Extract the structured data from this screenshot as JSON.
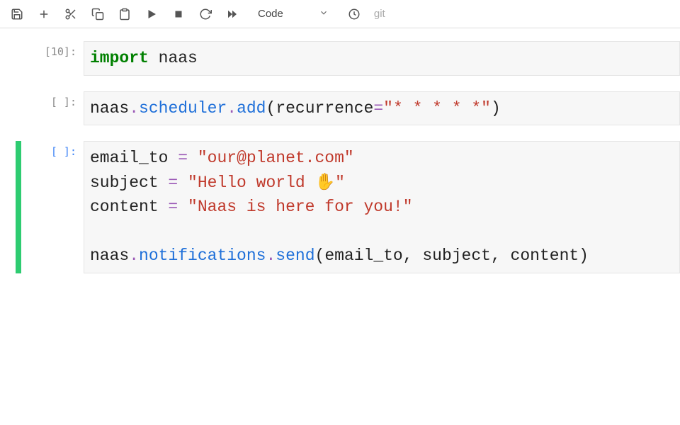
{
  "toolbar": {
    "cell_type": "Code",
    "git_label": "git"
  },
  "cells": [
    {
      "prompt": "[10]:",
      "active": false,
      "tokens": [
        {
          "t": "import",
          "c": "kw"
        },
        {
          "t": " ",
          "c": "name"
        },
        {
          "t": "naas",
          "c": "name"
        }
      ]
    },
    {
      "prompt": "[ ]:",
      "active": false,
      "tokens": [
        {
          "t": "naas",
          "c": "name"
        },
        {
          "t": ".",
          "c": "op"
        },
        {
          "t": "scheduler",
          "c": "call"
        },
        {
          "t": ".",
          "c": "op"
        },
        {
          "t": "add",
          "c": "call"
        },
        {
          "t": "(",
          "c": "paren"
        },
        {
          "t": "recurrence",
          "c": "name"
        },
        {
          "t": "=",
          "c": "op"
        },
        {
          "t": "\"* * * * *\"",
          "c": "str"
        },
        {
          "t": ")",
          "c": "paren"
        }
      ]
    },
    {
      "prompt": "[ ]:",
      "active": true,
      "tokens": [
        {
          "t": "email_to ",
          "c": "name"
        },
        {
          "t": "=",
          "c": "op"
        },
        {
          "t": " ",
          "c": "name"
        },
        {
          "t": "\"our@planet.com\"",
          "c": "str"
        },
        {
          "t": "\n",
          "c": "name"
        },
        {
          "t": "subject ",
          "c": "name"
        },
        {
          "t": "=",
          "c": "op"
        },
        {
          "t": " ",
          "c": "name"
        },
        {
          "t": "\"Hello world ✋\"",
          "c": "str"
        },
        {
          "t": "\n",
          "c": "name"
        },
        {
          "t": "content ",
          "c": "name"
        },
        {
          "t": "=",
          "c": "op"
        },
        {
          "t": " ",
          "c": "name"
        },
        {
          "t": "\"Naas is here for you!\"",
          "c": "str"
        },
        {
          "t": "\n\n",
          "c": "name"
        },
        {
          "t": "naas",
          "c": "name"
        },
        {
          "t": ".",
          "c": "op"
        },
        {
          "t": "notifications",
          "c": "call"
        },
        {
          "t": ".",
          "c": "op"
        },
        {
          "t": "send",
          "c": "call"
        },
        {
          "t": "(",
          "c": "paren"
        },
        {
          "t": "email_to, subject, content",
          "c": "name"
        },
        {
          "t": ")",
          "c": "paren"
        }
      ]
    }
  ]
}
